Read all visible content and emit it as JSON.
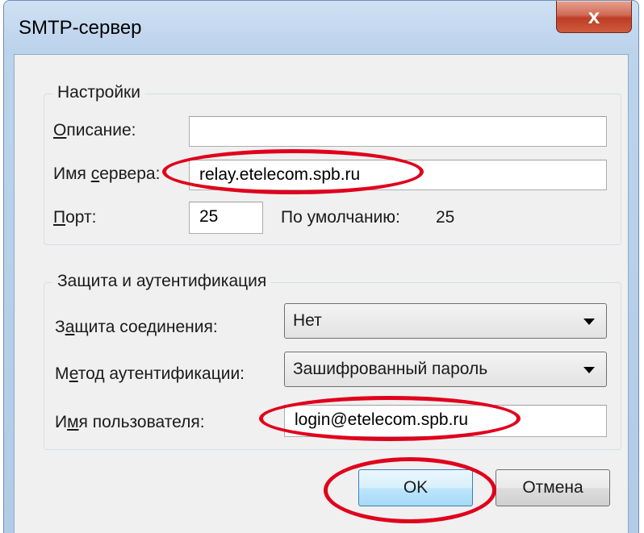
{
  "window": {
    "title": "SMTP-сервер",
    "close_label": "x"
  },
  "settings": {
    "legend": "Настройки",
    "description_label_u": "О",
    "description_label_rest": "писание:",
    "description_value": "",
    "server_label_pre": "Имя ",
    "server_label_u": "с",
    "server_label_rest": "ервера:",
    "server_value": "relay.etelecom.spb.ru",
    "port_label_u": "П",
    "port_label_rest": "орт:",
    "port_value": "25",
    "default_label": "По умолчанию:",
    "default_value": "25"
  },
  "security": {
    "legend": "Защита и аутентификация",
    "connection_label_pre": "З",
    "connection_label_u": "а",
    "connection_label_rest": "щита соединения:",
    "connection_value": "Нет",
    "auth_label_pre": "М",
    "auth_label_u": "е",
    "auth_label_rest": "тод аутентификации:",
    "auth_value": "Зашифрованный пароль",
    "user_label_pre": "И",
    "user_label_u": "м",
    "user_label_rest": "я пользователя:",
    "user_value": "login@etelecom.spb.ru"
  },
  "buttons": {
    "ok": "OK",
    "cancel": "Отмена"
  },
  "annotation_color": "#e0001b"
}
